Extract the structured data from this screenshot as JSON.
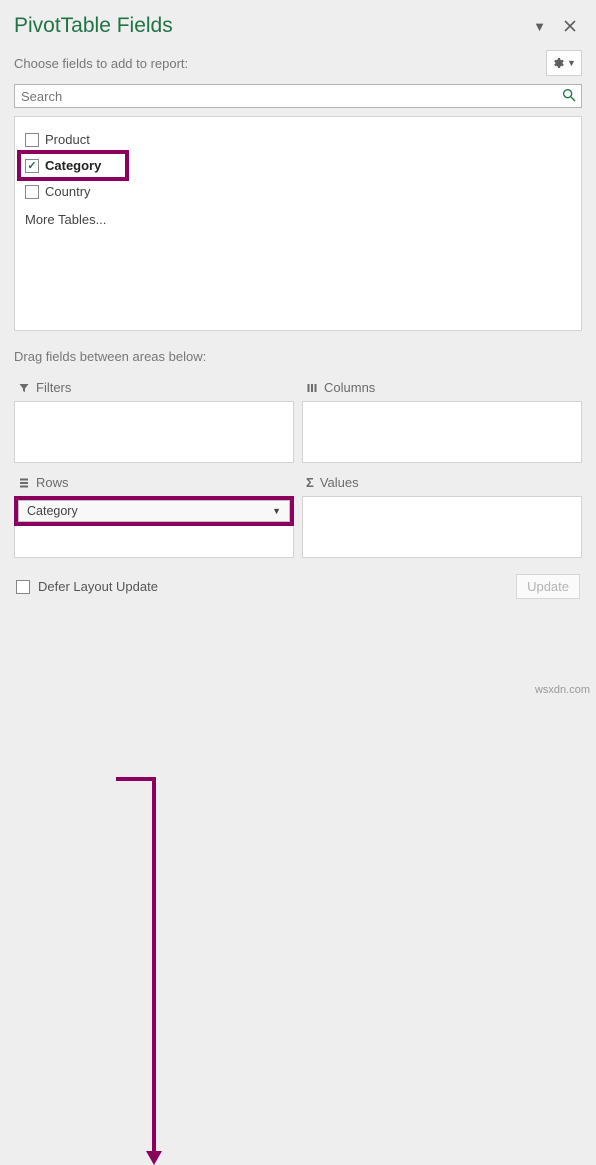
{
  "header": {
    "title": "PivotTable Fields",
    "subtitle": "Choose fields to add to report:"
  },
  "search": {
    "placeholder": "Search"
  },
  "fields": {
    "product": "Product",
    "category": "Category",
    "country": "Country",
    "more": "More Tables..."
  },
  "drag_text": "Drag fields between areas below:",
  "areas": {
    "filters": "Filters",
    "columns": "Columns",
    "rows": "Rows",
    "values": "Values"
  },
  "rows_item": "Category",
  "footer": {
    "defer": "Defer Layout Update",
    "update": "Update"
  },
  "watermark": "wsxdn.com"
}
